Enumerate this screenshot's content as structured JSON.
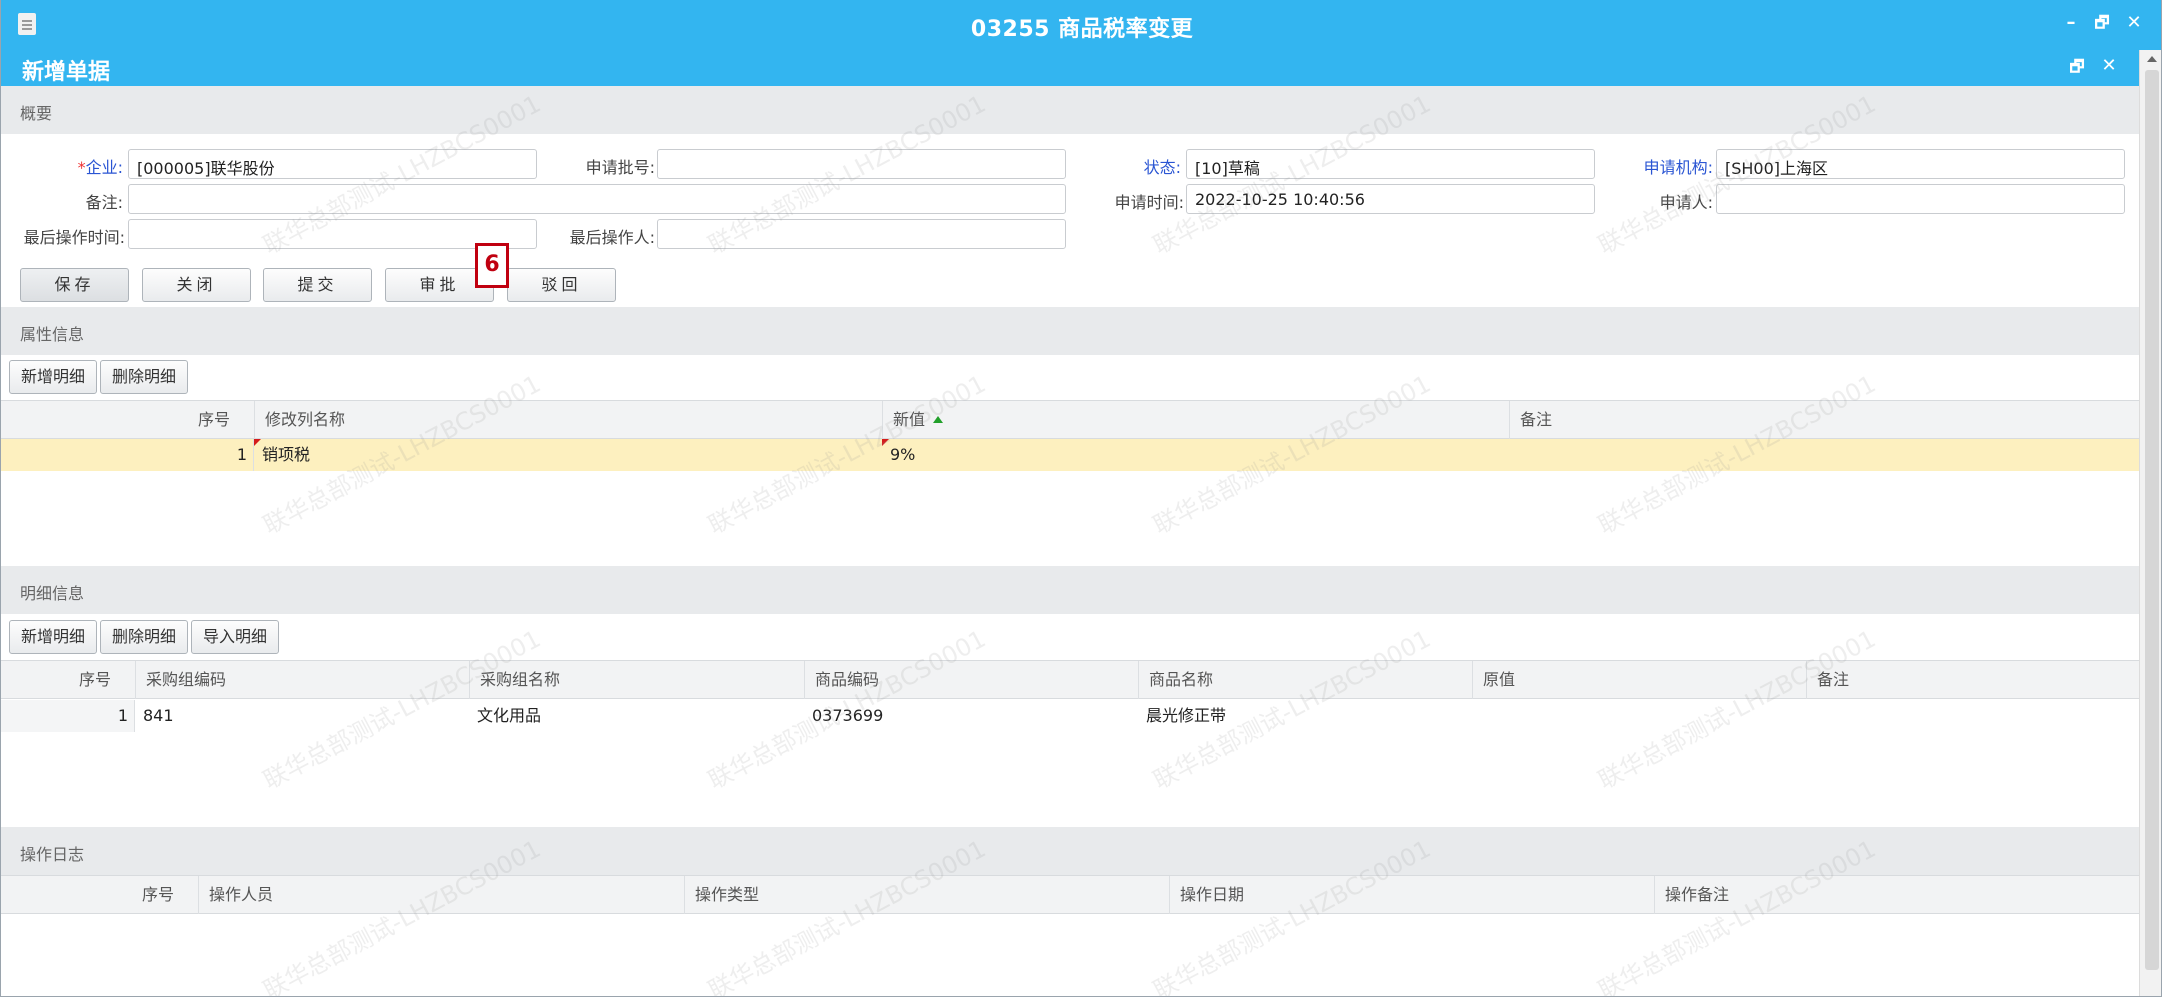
{
  "window": {
    "title": "03255 商品税率变更",
    "minimize": "–",
    "restore": "🗗",
    "close": "✕"
  },
  "panel": {
    "title": "新增单据",
    "restore": "🗗",
    "close": "✕"
  },
  "summary": {
    "section_title": "概要",
    "enterprise": {
      "required_mark": "*",
      "label": "企业:",
      "value": "[000005]联华股份"
    },
    "batch_no": {
      "label": "申请批号:",
      "value": ""
    },
    "status": {
      "label": "状态:",
      "value": "[10]草稿"
    },
    "org": {
      "label": "申请机构:",
      "value": "[SH00]上海区"
    },
    "remark": {
      "label": "备注:",
      "value": ""
    },
    "apply_time": {
      "label": "申请时间:",
      "value": "2022-10-25 10:40:56"
    },
    "applicant": {
      "label": "申请人:",
      "value": ""
    },
    "last_op_time": {
      "label": "最后操作时间:",
      "value": ""
    },
    "last_operator": {
      "label": "最后操作人:",
      "value": ""
    },
    "buttons": {
      "save": "保存",
      "close": "关闭",
      "submit": "提交",
      "approve": "审批",
      "reject": "驳回"
    },
    "annotation": "6"
  },
  "attributes": {
    "section_title": "属性信息",
    "buttons": {
      "add": "新增明细",
      "delete": "删除明细"
    },
    "columns": [
      "序号",
      "修改列名称",
      "新值",
      "备注"
    ],
    "rows": [
      {
        "seq": "1",
        "column_name": "销项税",
        "new_value": "9%",
        "remark": ""
      }
    ]
  },
  "details": {
    "section_title": "明细信息",
    "buttons": {
      "add": "新增明细",
      "delete": "删除明细",
      "import": "导入明细"
    },
    "columns": [
      "序号",
      "采购组编码",
      "采购组名称",
      "商品编码",
      "商品名称",
      "原值",
      "备注"
    ],
    "rows": [
      {
        "seq": "1",
        "group_code": "841",
        "group_name": "文化用品",
        "item_code": "0373699",
        "item_name": "晨光修正带",
        "old_value": "",
        "remark": ""
      }
    ]
  },
  "log": {
    "section_title": "操作日志",
    "columns": [
      "序号",
      "操作人员",
      "操作类型",
      "操作日期",
      "操作备注"
    ]
  },
  "watermark": "联华总部测试-LHZBCS0001",
  "colors": {
    "titlebar": "#33b5f0",
    "accent_label": "#2a55d3",
    "highlight_row": "#fdf0bf",
    "annotation": "#c00010"
  }
}
